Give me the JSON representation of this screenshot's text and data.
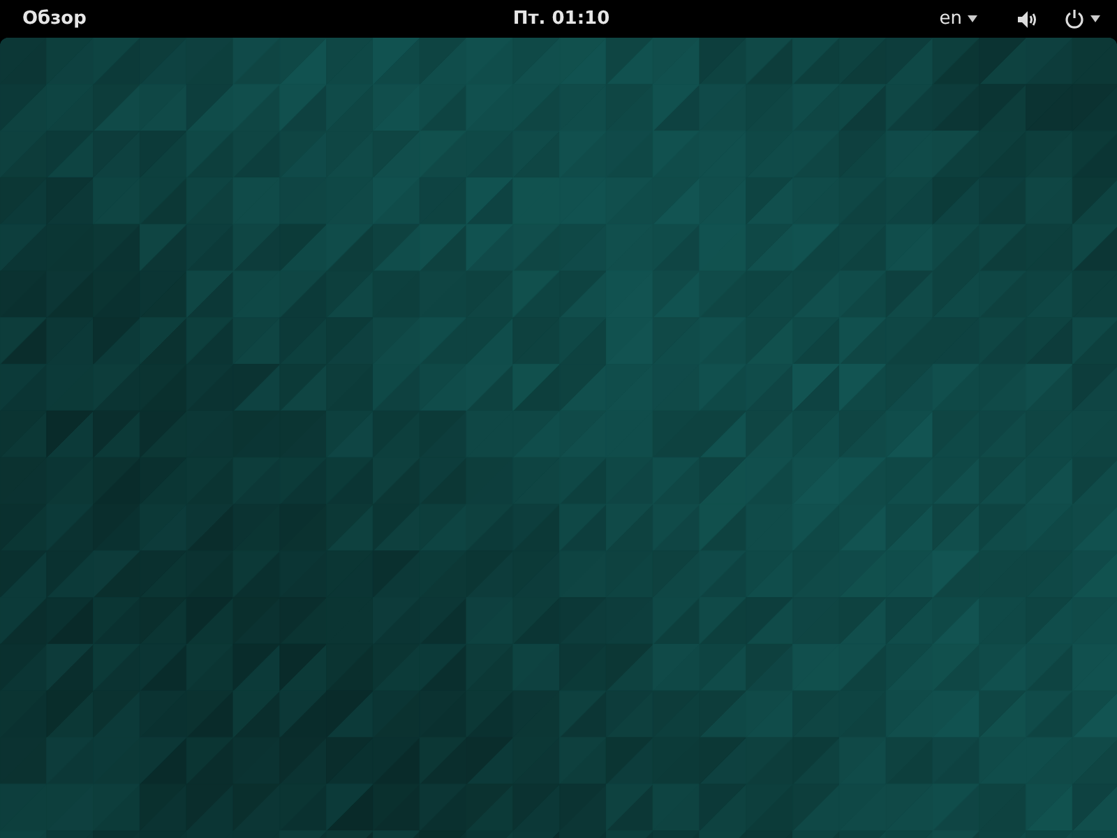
{
  "top_bar": {
    "activities": "Обзор",
    "clock": "Пт. 01:10",
    "keyboard_layout": "en"
  }
}
